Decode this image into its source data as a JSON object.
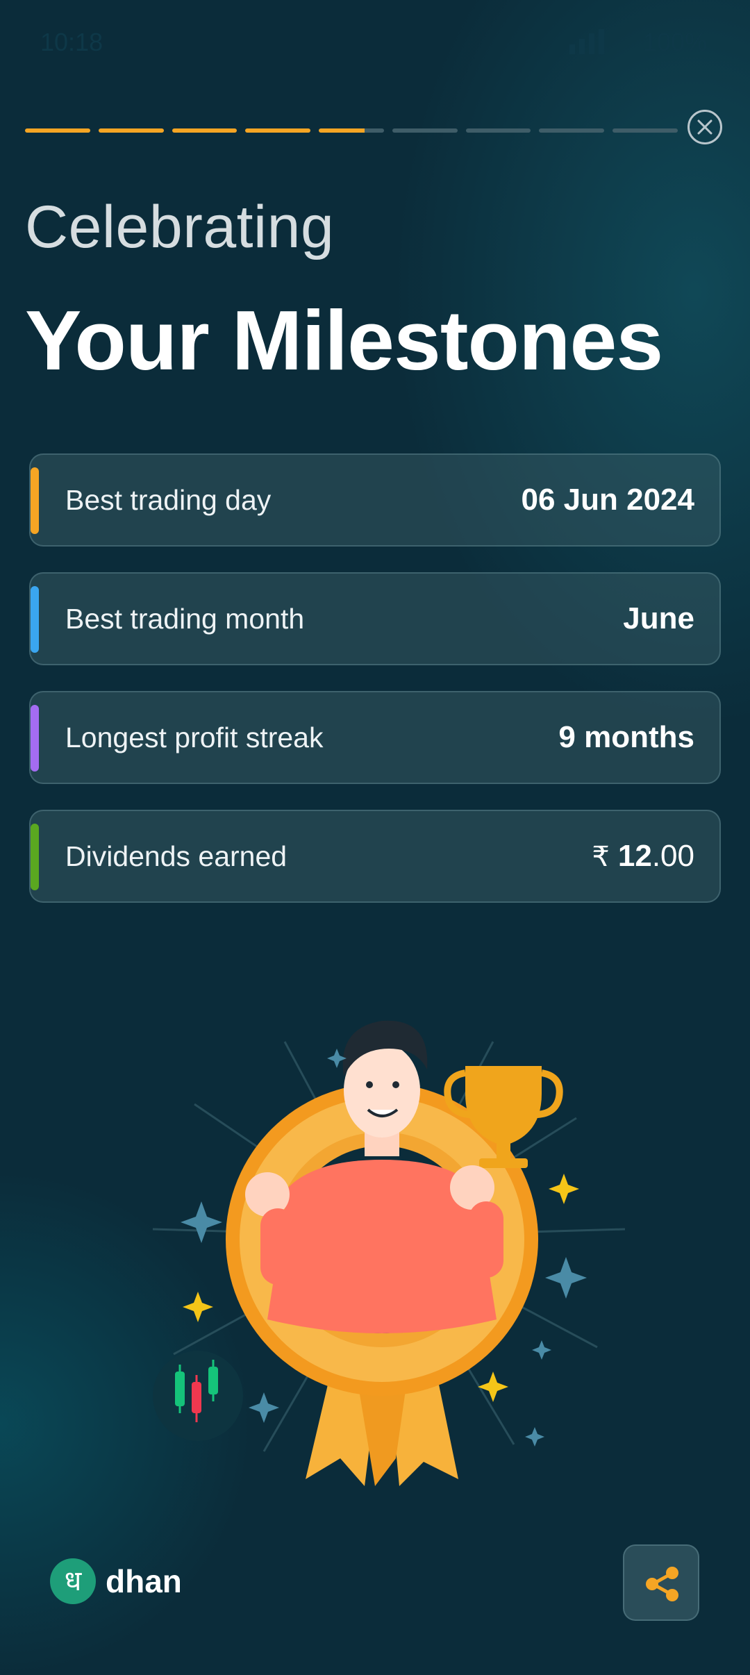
{
  "status_bar": {
    "time": "10:18",
    "battery": "100%"
  },
  "story_progress": {
    "segments_total": 9,
    "segments_done": 4,
    "current_fill_fraction": 0.7,
    "done_color": "#f5a524",
    "todo_color": "#3f5d68"
  },
  "header": {
    "subtitle": "Celebrating",
    "title": "Your Milestones"
  },
  "milestones": [
    {
      "label": "Best trading day",
      "value": "06 Jun 2024",
      "accent": "#f5a524"
    },
    {
      "label": "Best trading month",
      "value": "June",
      "accent": "#3aa6f0"
    },
    {
      "label": "Longest profit streak",
      "value": "9 months",
      "accent": "#a46cf2"
    },
    {
      "label": "Dividends earned",
      "currency": "₹",
      "value_int": "12",
      "value_dec": ".00",
      "accent": "#5aa820"
    }
  ],
  "footer": {
    "brand_glyph": "ध",
    "brand_name": "dhan"
  },
  "icons": {
    "close": "close-icon",
    "share": "share-icon"
  }
}
